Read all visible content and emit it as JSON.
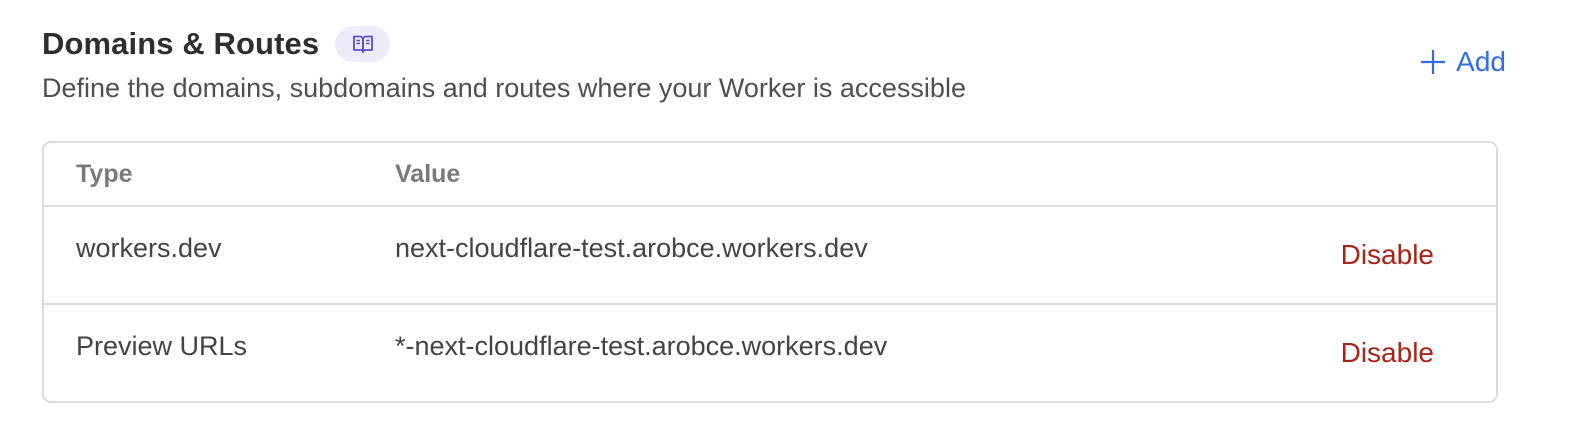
{
  "section": {
    "title": "Domains & Routes",
    "doc_icon": "book-open-icon",
    "description": "Define the domains, subdomains and routes where your Worker is accessible",
    "add_label": "Add",
    "add_icon": "plus-icon"
  },
  "table": {
    "columns": [
      "Type",
      "Value"
    ],
    "rows": [
      {
        "type": "workers.dev",
        "value": "next-cloudflare-test.arobce.workers.dev",
        "action": "Disable"
      },
      {
        "type": "Preview URLs",
        "value": "*-next-cloudflare-test.arobce.workers.dev",
        "action": "Disable"
      }
    ]
  },
  "colors": {
    "accent": "#2f6fe4",
    "danger": "#a82318",
    "chip_bg": "#eeecfb",
    "chip_icon": "#5b4fc9",
    "border": "#dcdcdc"
  }
}
